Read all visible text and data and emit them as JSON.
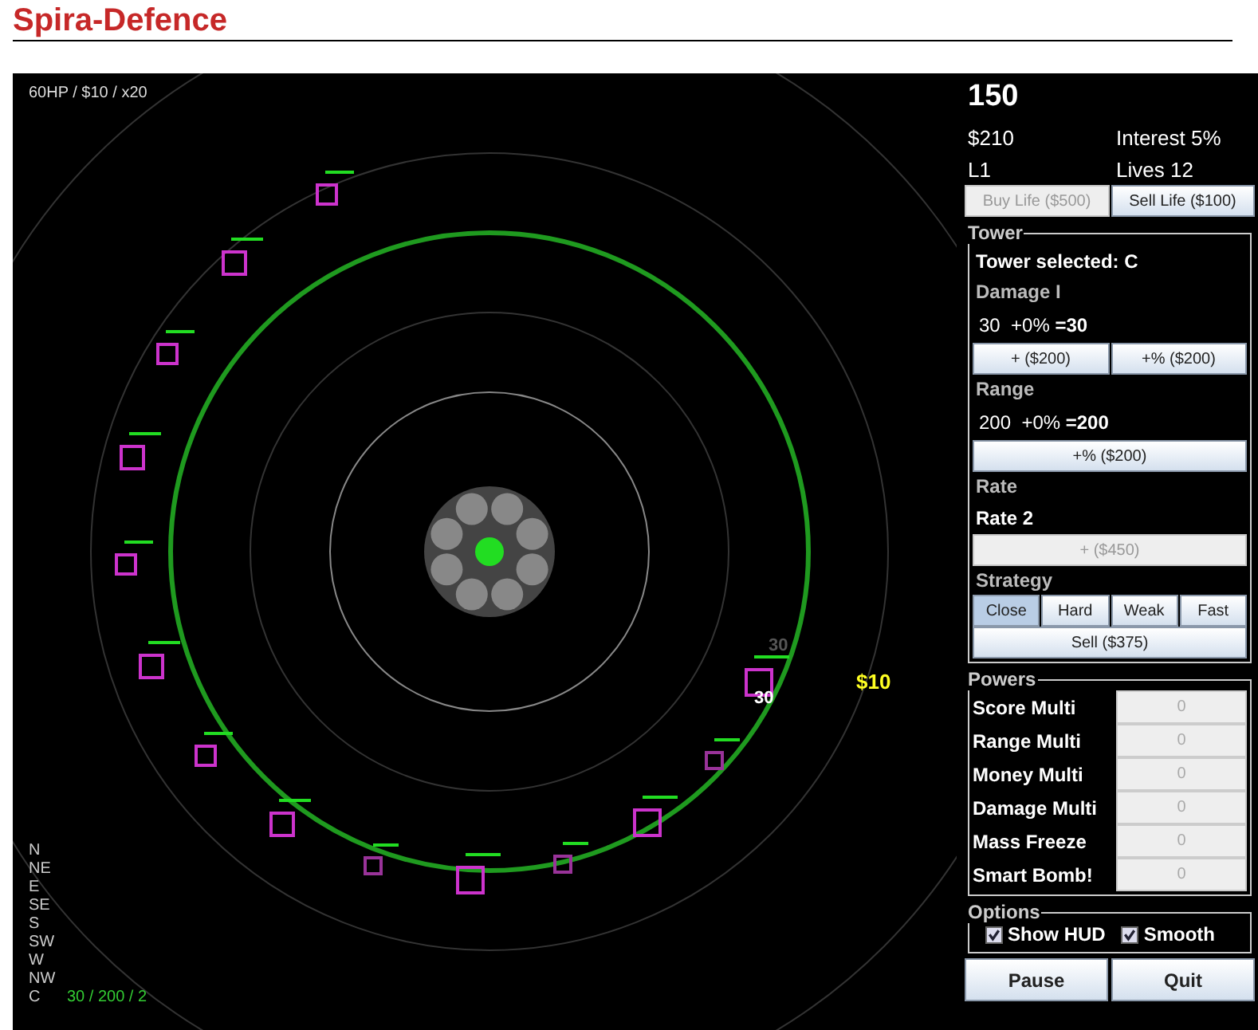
{
  "title": "Spira-Defence",
  "game": {
    "wave_info": "60HP / $10 / x20",
    "floating_texts": [
      {
        "kind": "dim",
        "text": "30"
      },
      {
        "kind": "damage",
        "text": "30"
      },
      {
        "kind": "money",
        "text": "$10"
      }
    ],
    "directions": [
      "N",
      "NE",
      "E",
      "SE",
      "S",
      "SW",
      "W",
      "NW",
      "C"
    ],
    "selected_stats": "30 / 200 / 2"
  },
  "panel": {
    "score": "150",
    "money": "$210",
    "interest": "Interest 5%",
    "level": "L1",
    "lives": "Lives 12",
    "life_buttons": [
      {
        "label": "Buy Life ($500)",
        "disabled": true
      },
      {
        "label": "Sell Life ($100)",
        "disabled": false
      }
    ],
    "tower": {
      "legend": "Tower",
      "rows": [
        {
          "kind": "value",
          "text": "Tower selected: C"
        },
        {
          "kind": "label",
          "text": "Damage I"
        },
        {
          "kind": "stat",
          "text": "30  +0% **=30**"
        },
        {
          "kind": "buttons",
          "buttons": [
            {
              "label": "+ ($200)",
              "disabled": false
            },
            {
              "label": "+% ($200)",
              "disabled": false
            }
          ]
        },
        {
          "kind": "label",
          "text": "Range"
        },
        {
          "kind": "stat",
          "text": "200  +0% **=200**"
        },
        {
          "kind": "buttons",
          "buttons": [
            {
              "label": "+% ($200)",
              "disabled": false
            }
          ]
        },
        {
          "kind": "label",
          "text": "Rate"
        },
        {
          "kind": "value",
          "text": "Rate 2"
        },
        {
          "kind": "buttons",
          "buttons": [
            {
              "label": "+ ($450)",
              "disabled": true
            }
          ]
        },
        {
          "kind": "label",
          "text": "Strategy"
        },
        {
          "kind": "choices",
          "choices": [
            {
              "label": "Close",
              "selected": true
            },
            {
              "label": "Hard",
              "selected": false
            },
            {
              "label": "Weak",
              "selected": false
            },
            {
              "label": "Fast",
              "selected": false
            }
          ]
        },
        {
          "kind": "buttons",
          "buttons": [
            {
              "label": "Sell ($375)",
              "disabled": false
            }
          ]
        }
      ]
    },
    "powers": {
      "legend": "Powers",
      "items": [
        {
          "label": "Score Multi",
          "value": "0"
        },
        {
          "label": "Range Multi",
          "value": "0"
        },
        {
          "label": "Money Multi",
          "value": "0"
        },
        {
          "label": "Damage Multi",
          "value": "0"
        },
        {
          "label": "Mass Freeze",
          "value": "0"
        },
        {
          "label": "Smart Bomb!",
          "value": "0"
        }
      ]
    },
    "options": {
      "legend": "Options",
      "items": [
        {
          "label": "Show HUD",
          "checked": true
        },
        {
          "label": "Smooth",
          "checked": true
        }
      ]
    },
    "buttons": [
      "Pause",
      "Quit"
    ]
  }
}
